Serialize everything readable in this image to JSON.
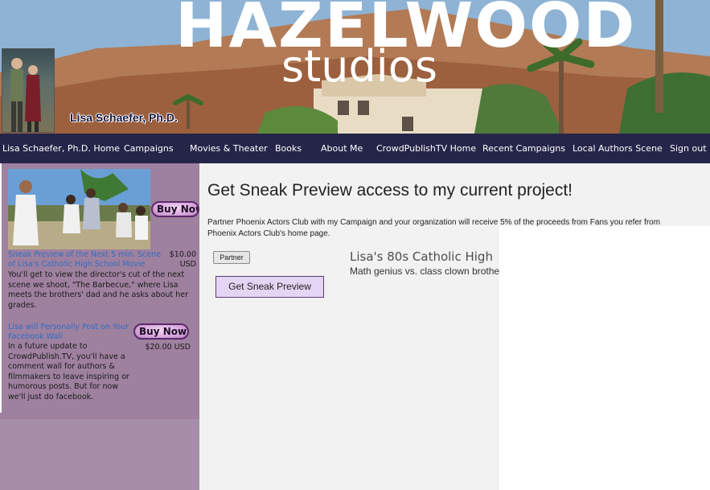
{
  "banner": {
    "title": "HAZELWOOD",
    "subtitle": "studios",
    "profile_name": "Lisa Schaefer, Ph.D."
  },
  "nav": {
    "items": [
      {
        "label": "Lisa Schaefer, Ph.D. Home"
      },
      {
        "label": "Campaigns"
      },
      {
        "label": "Movies & Theater"
      },
      {
        "label": "Books"
      },
      {
        "label": "About Me"
      },
      {
        "label": "CrowdPublishTV Home"
      },
      {
        "label": "Recent Campaigns"
      },
      {
        "label": "Local Authors Scene"
      },
      {
        "label": "Sign out"
      }
    ]
  },
  "rewards": [
    {
      "buy_label": "Buy Now",
      "title": "Sneak Preview of the Next 5 min. Scene of Lisa's Catholic High School Movie",
      "price": "$10.00 USD",
      "description": "You'll get to view the director's cut of the next scene we shoot, \"The Barbecue,\" where Lisa meets the brothers' dad and he asks about her grades."
    },
    {
      "buy_label": "Buy Now",
      "title": "Lisa will Personally Post on Your Facebook Wall",
      "price": "$20.00 USD",
      "description": "In a future update to CrowdPublish.TV, you'll have a comment wall for authors & filmmakers to leave inspiring or humorous posts. But for now we'll just do facebook."
    }
  ],
  "main": {
    "heading": "Get Sneak Preview access to my current project!",
    "partner_text": "Partner Phoenix Actors Club with my Campaign and your organization will receive 5% of the proceeds from Fans you refer from Phoenix Actors Club's home page.",
    "partner_button": "Partner",
    "sneak_button": "Get Sneak Preview",
    "campaign_title": "Lisa's 80s Catholic High",
    "campaign_tagline": "Math genius vs. class clown brothers"
  },
  "colors": {
    "nav_background": "#25254a",
    "sidebar_background": "#a68da8",
    "link": "#2e6fc2",
    "sneak_button": "#e5d5f4"
  }
}
